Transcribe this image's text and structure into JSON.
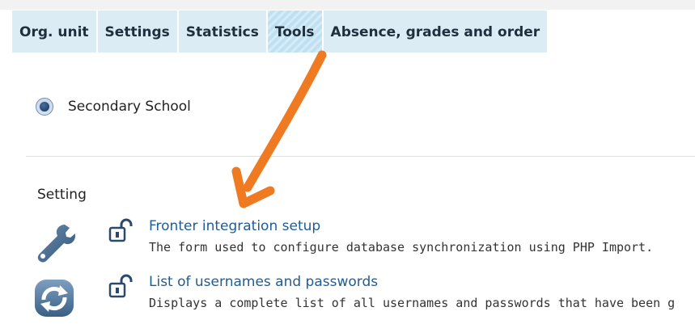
{
  "tabs": [
    {
      "label": "Org. unit",
      "active": false
    },
    {
      "label": "Settings",
      "active": false
    },
    {
      "label": "Statistics",
      "active": false
    },
    {
      "label": "Tools",
      "active": true
    },
    {
      "label": "Absence, grades and order",
      "active": false
    }
  ],
  "school": {
    "label": "Secondary School",
    "selected": true
  },
  "section": {
    "title": "Setting"
  },
  "tools": [
    {
      "icon": "wrench-icon",
      "lock": "unlocked-padlock-icon",
      "link": "Fronter integration setup",
      "description": "The form used to configure database synchronization using PHP Import."
    },
    {
      "icon": "refresh-icon",
      "lock": "unlocked-padlock-icon",
      "link": "List of usernames and passwords",
      "description": "Displays a complete list of all usernames and passwords that have been g"
    }
  ],
  "colors": {
    "tab_bg": "#dcecf5",
    "tab_active_bg": "#bfe0f2",
    "link": "#1e5c96",
    "arrow": "#f07a21"
  }
}
